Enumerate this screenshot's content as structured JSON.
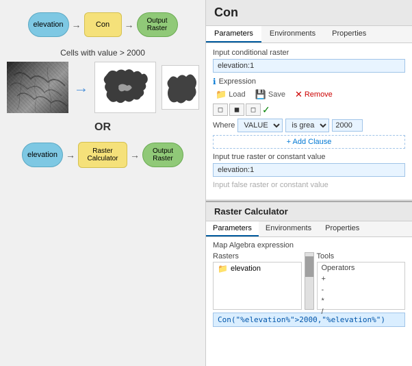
{
  "left": {
    "flow1": {
      "node1": "elevation",
      "node2": "Con",
      "node3": "Output\nRaster"
    },
    "cells_label": "Cells with value > 2000",
    "or_label": "OR",
    "flow2": {
      "node1": "elevation",
      "node2": "Raster\nCalculator",
      "node3": "Output\nRaster"
    }
  },
  "right": {
    "con_title": "Con",
    "tabs": [
      "Parameters",
      "Environments",
      "Properties"
    ],
    "active_tab": "Parameters",
    "input_label": "Input conditional raster",
    "input_value": "elevation:1",
    "expr_label": "Expression",
    "btn_load": "Load",
    "btn_save": "Save",
    "btn_remove": "Remove",
    "where_label": "Where",
    "where_field": "VALUE",
    "where_op": "is grea",
    "where_val": "2000",
    "add_clause": "+ Add Clause",
    "true_raster_label": "Input true raster or constant value",
    "true_raster_value": "elevation:1",
    "false_raster_label": "Input false raster or constant value",
    "raster_calc": {
      "title": "Raster Calculator",
      "tabs": [
        "Parameters",
        "Environments",
        "Properties"
      ],
      "active_tab": "Parameters",
      "map_label": "Map Algebra expression",
      "rasters_label": "Rasters",
      "tools_label": "Tools",
      "raster_item": "elevation",
      "tools_items": [
        "Operators",
        "+",
        "-",
        "*",
        "/"
      ],
      "expr_output": "Con(\"%elevation%\">2000,\"%elevation%\")"
    }
  }
}
